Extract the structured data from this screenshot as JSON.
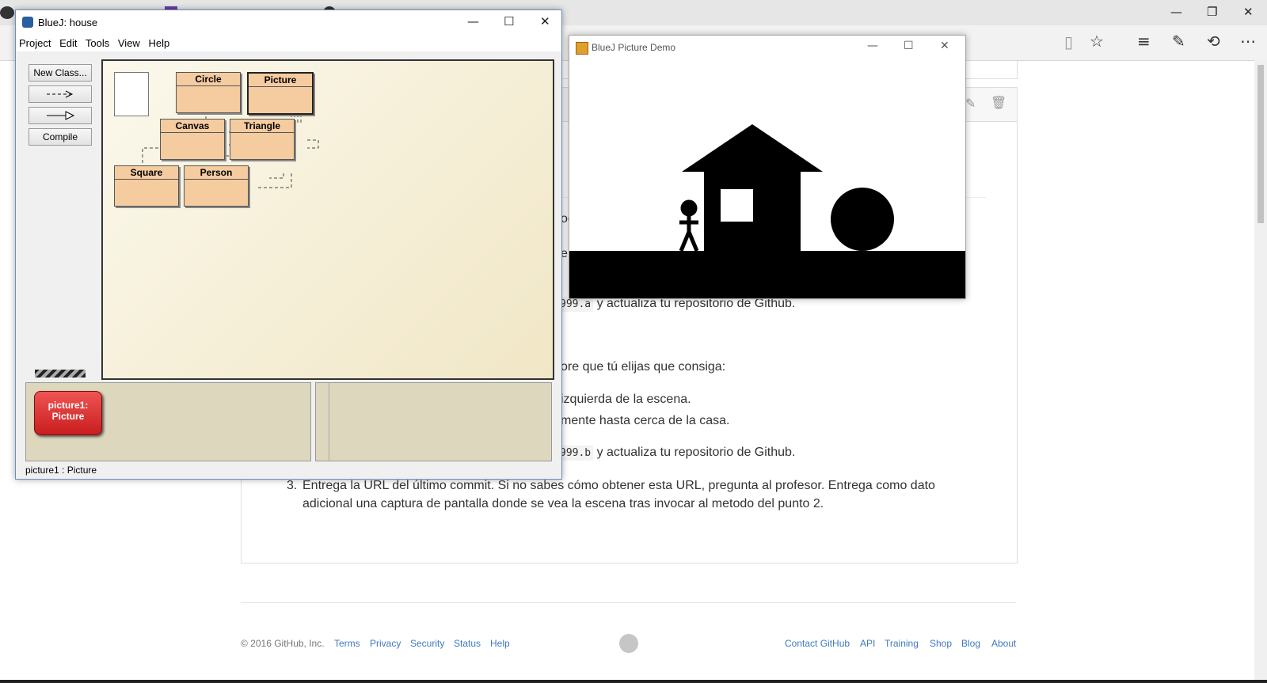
{
  "browser": {
    "window_controls": {
      "minimize": "—",
      "restore": "❐",
      "close": "✕"
    },
    "toolbar_icons": [
      "reading-view-icon",
      "favorite-star-icon",
      "hub-icon",
      "web-note-icon",
      "share-icon",
      "more-icon"
    ]
  },
  "github": {
    "line1_fragment": "og",
    "line2_fragment": "e",
    "code_a": "999.a",
    "after_code_a": " y actualiza tu repositorio de Github.",
    "line_choose": "ore que tú elijas que consiga:",
    "bullet1": "izquierda de la escena.",
    "bullet2": "mente hasta cerca de la casa.",
    "code_b": "999.b",
    "after_code_b": " y actualiza tu repositorio de Github.",
    "item3_number": "3.",
    "item3_line1": "Entrega la URL del último commit. Si no sabes cómo obtener esta URL, pregunta al profesor. Entrega como dato",
    "item3_line2": "adicional una captura de pantalla donde se vea la escena tras invocar al metodo del punto 2."
  },
  "footer": {
    "copyright": "© 2016 GitHub, Inc.",
    "left_links": [
      "Terms",
      "Privacy",
      "Security",
      "Status",
      "Help"
    ],
    "right_links": [
      "Contact GitHub",
      "API",
      "Training",
      "Shop",
      "Blog",
      "About"
    ]
  },
  "bluej": {
    "title": "BlueJ:  house",
    "menu": [
      "Project",
      "Edit",
      "Tools",
      "View",
      "Help"
    ],
    "new_class": "New Class...",
    "compile": "Compile",
    "classes": [
      "Circle",
      "Picture",
      "Canvas",
      "Triangle",
      "Square",
      "Person"
    ],
    "object_name": "picture1:",
    "object_type": "Picture",
    "status": "picture1 : Picture"
  },
  "demo": {
    "title": "BlueJ Picture Demo",
    "colors": {
      "scene_bg": "#ffffff",
      "shapes": "#000000"
    }
  },
  "colors": {
    "link": "#4078c0",
    "class_box": "#f5cba0",
    "object": "#d32a2a"
  }
}
